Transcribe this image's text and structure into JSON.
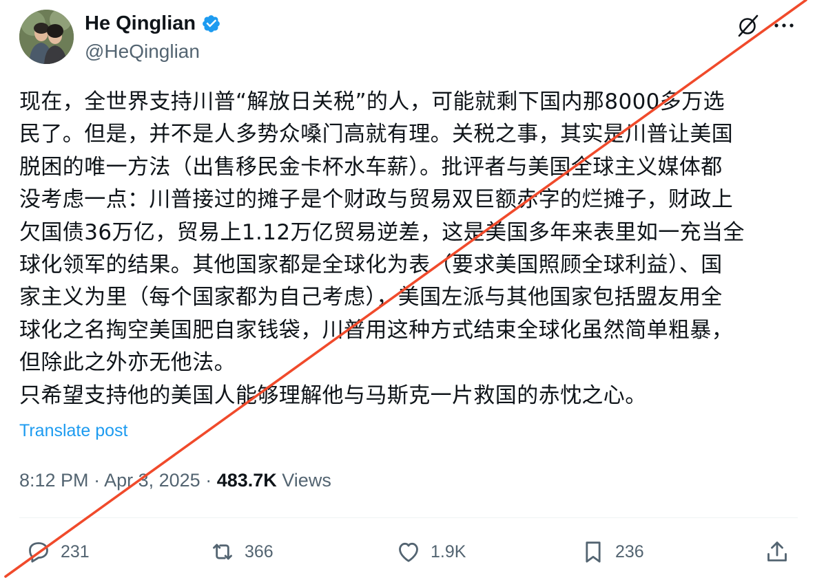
{
  "author": {
    "name": "He Qinglian",
    "handle": "@HeQinglian",
    "avatar_icon": "profile-photo",
    "verified_icon": "verified-badge-icon",
    "verified_color": "#1d9bf0"
  },
  "header_icons": [
    "grok-icon",
    "more-icon"
  ],
  "post": {
    "lines": [
      "现在，全世界支持川普“解放日关税”的人，可能就剩下国内那8000多万选",
      "民了。但是，并不是人多势众嗓门高就有理。关税之事，其实是川普让美国",
      "脱困的唯一方法（出售移民金卡杯水车薪）。批评者与美国全球主义媒体都",
      "没考虑一点：川普接过的摊子是个财政与贸易双巨额赤字的烂摊子，财政上",
      "欠国债36万亿，贸易上1.12万亿贸易逆差，这是美国多年来表里如一充当全",
      "球化领军的结果。其他国家都是全球化为表（要求美国照顾全球利益）、国",
      "家主义为里（每个国家都为自己考虑），美国左派与其他国家包括盟友用全",
      "球化之名掏空美国肥自家钱袋，川普用这种方式结束全球化虽然简单粗暴，",
      "但除此之外亦无他法。",
      "只希望支持他的美国人能够理解他与马斯克一片救国的赤忱之心。"
    ],
    "translate_label": "Translate post"
  },
  "meta": {
    "time": "8:12 PM",
    "separator": " · ",
    "date": "Apr 3, 2025",
    "views_count": "483.7K",
    "views_label": "Views"
  },
  "actions": {
    "replies": "231",
    "reposts": "366",
    "likes": "1.9K",
    "bookmarks": "236"
  },
  "colors": {
    "text": "#0f1419",
    "secondary": "#536471",
    "link": "#1d9bf0",
    "overlay_slash": "#f04a2b"
  }
}
